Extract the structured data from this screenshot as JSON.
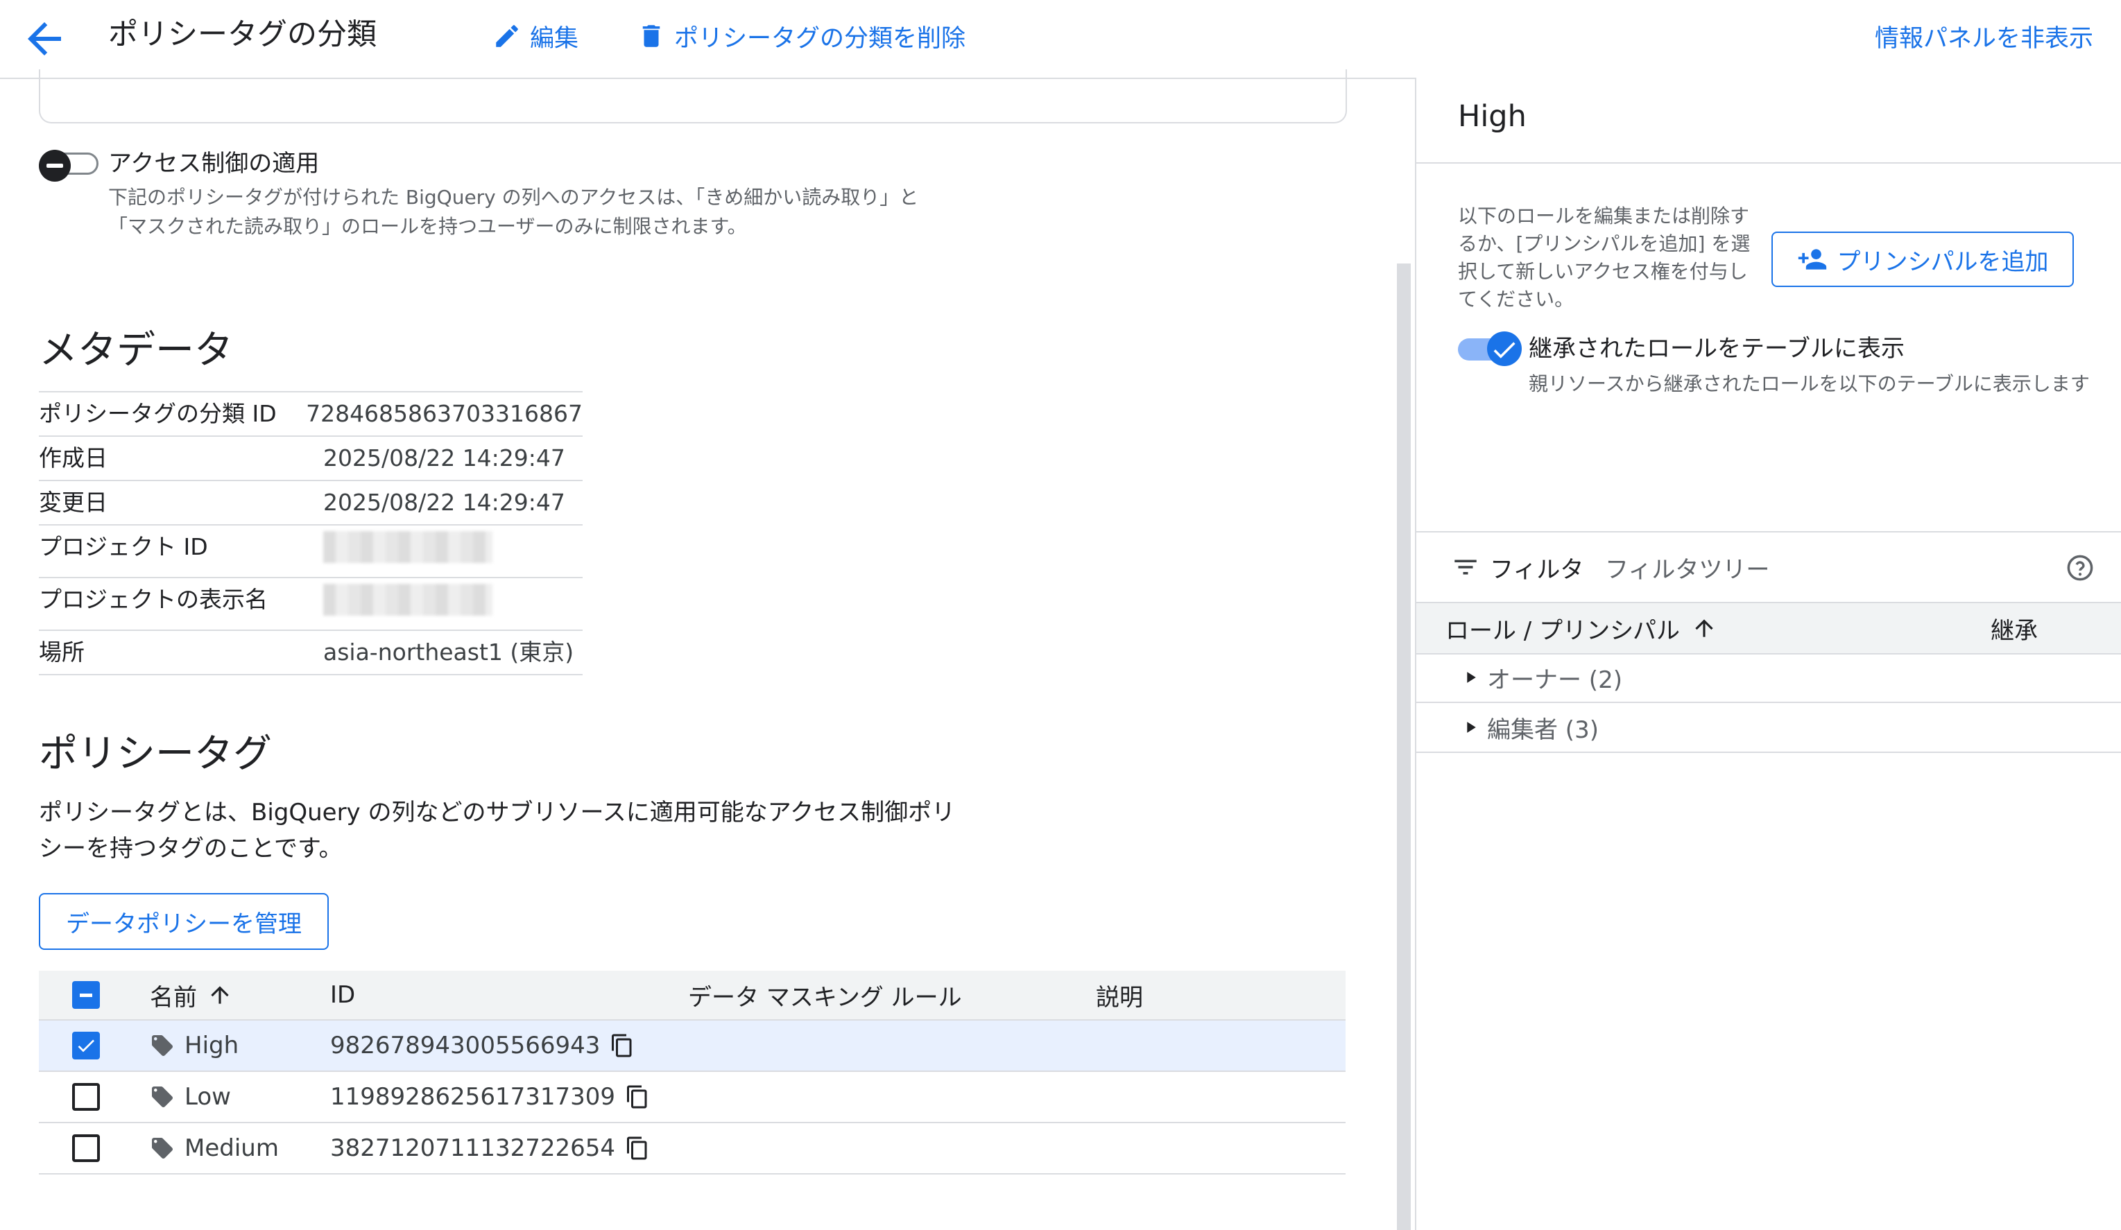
{
  "toolbar": {
    "title": "ポリシータグの分類",
    "edit_label": "編集",
    "delete_label": "ポリシータグの分類を削除",
    "hide_panel_label": "情報パネルを非表示"
  },
  "access_control": {
    "label": "アクセス制御の適用",
    "description": "下記のポリシータグが付けられた BigQuery の列へのアクセスは、「きめ細かい読み取り」と「マスクされた読み取り」のロールを持つユーザーのみに制限されます。",
    "enabled": false
  },
  "metadata": {
    "heading": "メタデータ",
    "rows": [
      {
        "key": "ポリシータグの分類 ID",
        "value": "7284685863703316867"
      },
      {
        "key": "作成日",
        "value": "2025/08/22 14:29:47"
      },
      {
        "key": "変更日",
        "value": "2025/08/22 14:29:47"
      },
      {
        "key": "プロジェクト ID",
        "value": ""
      },
      {
        "key": "プロジェクトの表示名",
        "value": ""
      },
      {
        "key": "場所",
        "value": "asia-northeast1 (東京)"
      }
    ]
  },
  "policy_tags": {
    "heading": "ポリシータグ",
    "description": "ポリシータグとは、BigQuery の列などのサブリソースに適用可能なアクセス制御ポリシーを持つタグのことです。",
    "manage_button": "データポリシーを管理",
    "columns": {
      "name": "名前",
      "id": "ID",
      "masking": "データ マスキング ルール",
      "description": "説明"
    },
    "rows": [
      {
        "name": "High",
        "id": "982678943005566943",
        "masking": "",
        "description": "",
        "selected": true
      },
      {
        "name": "Low",
        "id": "1198928625617317309",
        "masking": "",
        "description": "",
        "selected": false
      },
      {
        "name": "Medium",
        "id": "3827120711132722654",
        "masking": "",
        "description": "",
        "selected": false
      }
    ]
  },
  "info_panel": {
    "title": "High",
    "description": "以下のロールを編集または削除するか、[プリンシパルを追加] を選択して新しいアクセス権を付与してください。",
    "add_principal_button": "プリンシパルを追加",
    "show_inherited_label": "継承されたロールをテーブルに表示",
    "show_inherited_desc": "親リソースから継承されたロールを以下のテーブルに表示します",
    "show_inherited_enabled": true,
    "filter_label": "フィルタ",
    "filter_placeholder": "フィルタツリー",
    "columns": {
      "role": "ロール / プリンシパル",
      "inherited": "継承"
    },
    "roles": [
      {
        "label": "オーナー (2)"
      },
      {
        "label": "編集者 (3)"
      }
    ]
  },
  "colors": {
    "accent": "#1a73e8",
    "border": "#dadce0",
    "selected_row": "#e8f0fe",
    "header_bg": "#f1f3f4"
  }
}
